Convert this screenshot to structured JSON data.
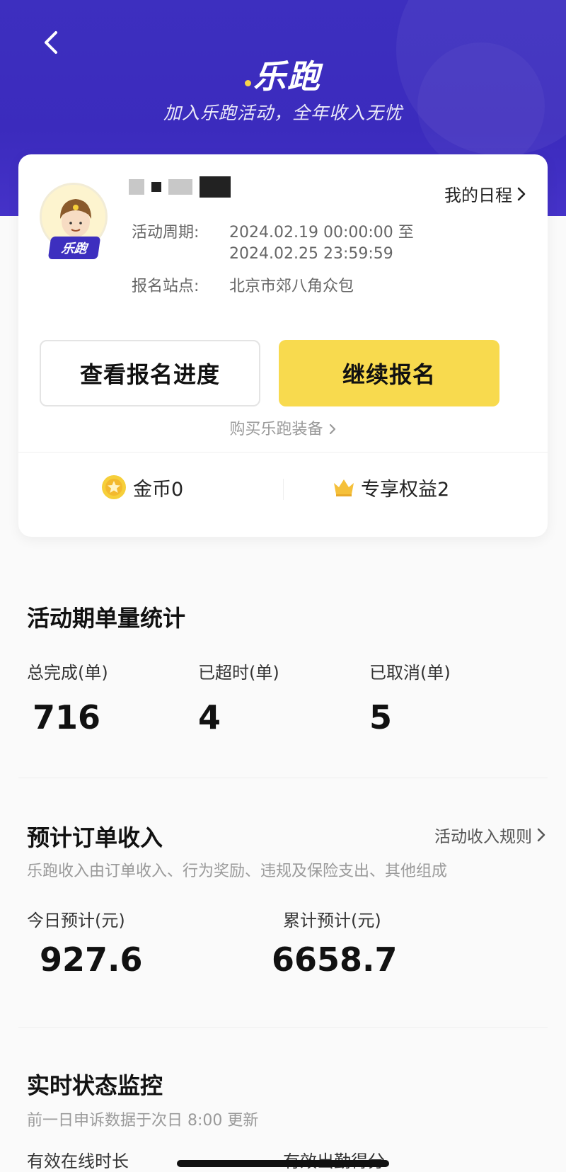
{
  "header": {
    "brand": "乐跑",
    "slogan": "加入乐跑活动，全年收入无忧",
    "background_color": "#3d2fbf"
  },
  "profile": {
    "badge": "乐跑",
    "schedule_link": "我的日程",
    "period_label": "活动周期:",
    "period_start": "2024.02.19 00:00:00 至",
    "period_end": "2024.02.25 23:59:59",
    "station_label": "报名站点:",
    "station_value": "北京市郊八角众包"
  },
  "actions": {
    "view_progress": "查看报名进度",
    "continue_signup": "继续报名",
    "buy_equipment": "购买乐跑装备"
  },
  "stats": {
    "coins_label": "金币0",
    "benefits_label": "专享权益2"
  },
  "order_stats": {
    "title": "活动期单量统计",
    "items": [
      {
        "label": "总完成(单)",
        "value": "716"
      },
      {
        "label": "已超时(单)",
        "value": "4"
      },
      {
        "label": "已取消(单)",
        "value": "5"
      }
    ]
  },
  "income": {
    "title": "预计订单收入",
    "rules_link": "活动收入规则",
    "description": "乐跑收入由订单收入、行为奖励、违规及保险支出、其他组成",
    "today_label": "今日预计(元)",
    "today_value": "927.6",
    "total_label": "累计预计(元)",
    "total_value": "6658.7"
  },
  "monitor": {
    "title": "实时状态监控",
    "note": "前一日申诉数据于次日 8:00 更新",
    "online_label": "有效在线时长",
    "attendance_label": "有效出勤得分"
  },
  "colors": {
    "accent_yellow": "#f8da4e",
    "brand_purple": "#3d2fbf"
  }
}
